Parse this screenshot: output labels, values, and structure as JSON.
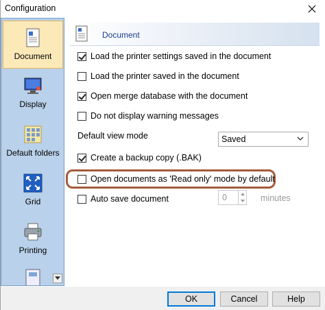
{
  "window": {
    "title": "Configuration"
  },
  "sidebar": {
    "items": [
      {
        "label": "Document",
        "icon": "document-icon",
        "active": true
      },
      {
        "label": "Display",
        "icon": "display-icon",
        "active": false
      },
      {
        "label": "Default folders",
        "icon": "folders-icon",
        "active": false
      },
      {
        "label": "Grid",
        "icon": "grid-icon",
        "active": false
      },
      {
        "label": "Printing",
        "icon": "printer-icon",
        "active": false
      }
    ]
  },
  "panel": {
    "title": "Document",
    "options": {
      "load_printer_settings": {
        "label": "Load the printer settings saved in the document",
        "checked": true
      },
      "load_printer": {
        "label": "Load the printer saved in the document",
        "checked": false
      },
      "open_merge_db": {
        "label": "Open merge database with the document",
        "checked": true
      },
      "no_warnings": {
        "label": "Do not display warning messages",
        "checked": false
      },
      "backup_copy": {
        "label": "Create a backup copy (.BAK)",
        "checked": true
      },
      "read_only": {
        "label": "Open documents as 'Read only' mode by default",
        "checked": false
      },
      "auto_save": {
        "label": "Auto save document",
        "checked": false
      }
    },
    "default_view": {
      "label": "Default view mode",
      "value": "Saved"
    },
    "auto_save_minutes": {
      "value": "0",
      "unit": "minutes"
    }
  },
  "footer": {
    "ok": "OK",
    "cancel": "Cancel",
    "help": "Help"
  },
  "colors": {
    "sidebar_bg": "#b9d1ea",
    "active_item": "#fce9b8",
    "highlight_ring": "#a25c3c",
    "accent": "#0078d7"
  }
}
